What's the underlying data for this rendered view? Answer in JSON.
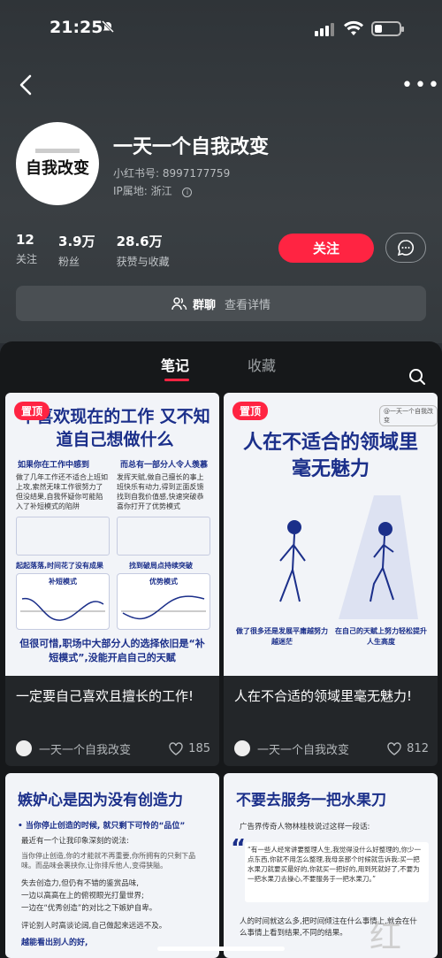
{
  "status": {
    "time": "21:25"
  },
  "profile": {
    "avatar_text": "自我改变",
    "name": "一天一个自我改变",
    "id_label": "小红书号: 8997177759",
    "ip_label": "IP属地: 浙江"
  },
  "stats": [
    {
      "num": "12",
      "label": "关注"
    },
    {
      "num": "3.9万",
      "label": "粉丝"
    },
    {
      "num": "28.6万",
      "label": "获赞与收藏"
    }
  ],
  "actions": {
    "follow": "关注"
  },
  "group": {
    "title": "群聊",
    "detail": "查看详情"
  },
  "tabs": {
    "notes": "笔记",
    "collect": "收藏"
  },
  "cards": [
    {
      "badge": "置顶",
      "cover_title": "不喜欢现在的工作 又不知道自己想做什么",
      "cover_left_head": "如果你在工作中感到",
      "cover_right_head": "而总有一部分人令人羡慕",
      "cover_left_text": "做了几年工作还不适合上班如上攻,索然无味工作很努力了但没结果,自我怀疑你可能陷入了补短模式的陷阱",
      "cover_right_text": "发挥天赋,做自己擅长的事上班快乐有动力,得到正面反馈找到自我价值感,快速突破恭喜你打开了优势模式",
      "cover_left_chart": "补短模式",
      "cover_right_chart": "优势模式",
      "cover_left_sub": "起起落落,时间花了没有成果",
      "cover_right_sub": "找到破局点持续突破",
      "cover_footer": "但很可惜,职场中大部分人的选择依旧是“补短模式”,没能开启自己的天赋",
      "title": "一定要自己喜欢且擅长的工作!",
      "author": "一天一个自我改变",
      "likes": "185"
    },
    {
      "badge": "置顶",
      "tag": "@一天一个自我改变",
      "cover_title": "人在不适合的领域里毫无魅力",
      "cover_left_cap": "做了很多还是发展平庸越努力越迷茫",
      "cover_right_cap": "在自己的天赋上努力轻松提升人生高度",
      "title": "人在不合适的领域里毫无魅力!",
      "author": "一天一个自我改变",
      "likes": "812"
    },
    {
      "cover_title": "嫉妒心是因为没有创造力",
      "cover_sub": "• 当你停止创造的时候, 就只剩下可怜的“品位”",
      "cover_p1": "最近有一个让我印象深刻的说法:",
      "cover_p2": "当你停止创造,你的才能就不再重要,你所拥有的只剩下品味。而品味会裹挟你,让你排斥他人,变得狭隘。",
      "cover_p3": "失去创造力,但仍有不错的鉴赏品味,",
      "cover_p4": "一边以高高在上的俯视眼光打量世界;",
      "cover_p5": "一边在“优秀创造”的对比之下嫉妒自卑。",
      "cover_p6": "评论别人时高谈论阔,自己做起来远远不及。",
      "cover_p7": "越能看出别人的好,"
    },
    {
      "cover_title": "不要去服务一把水果刀",
      "cover_p1": "广告界传奇人物林桂枝说过这样一段话:",
      "cover_quote": "“有一些人经常讲要整理人生,我觉得没什么好整理的,你少一点东西,你就不用怎么整理,我母亲那个时候就告诉我:买一把水果刀就要买最好的,你就买一把好的,用到死就好了,不要为一把水果刀去操心,不要服务于一把水果刀。”",
      "cover_p2": "人的时间就这么多,把时间倾注在什么事情上,就会在什么事情上看到结果,不同的结果。"
    }
  ],
  "watermark": "红 草"
}
